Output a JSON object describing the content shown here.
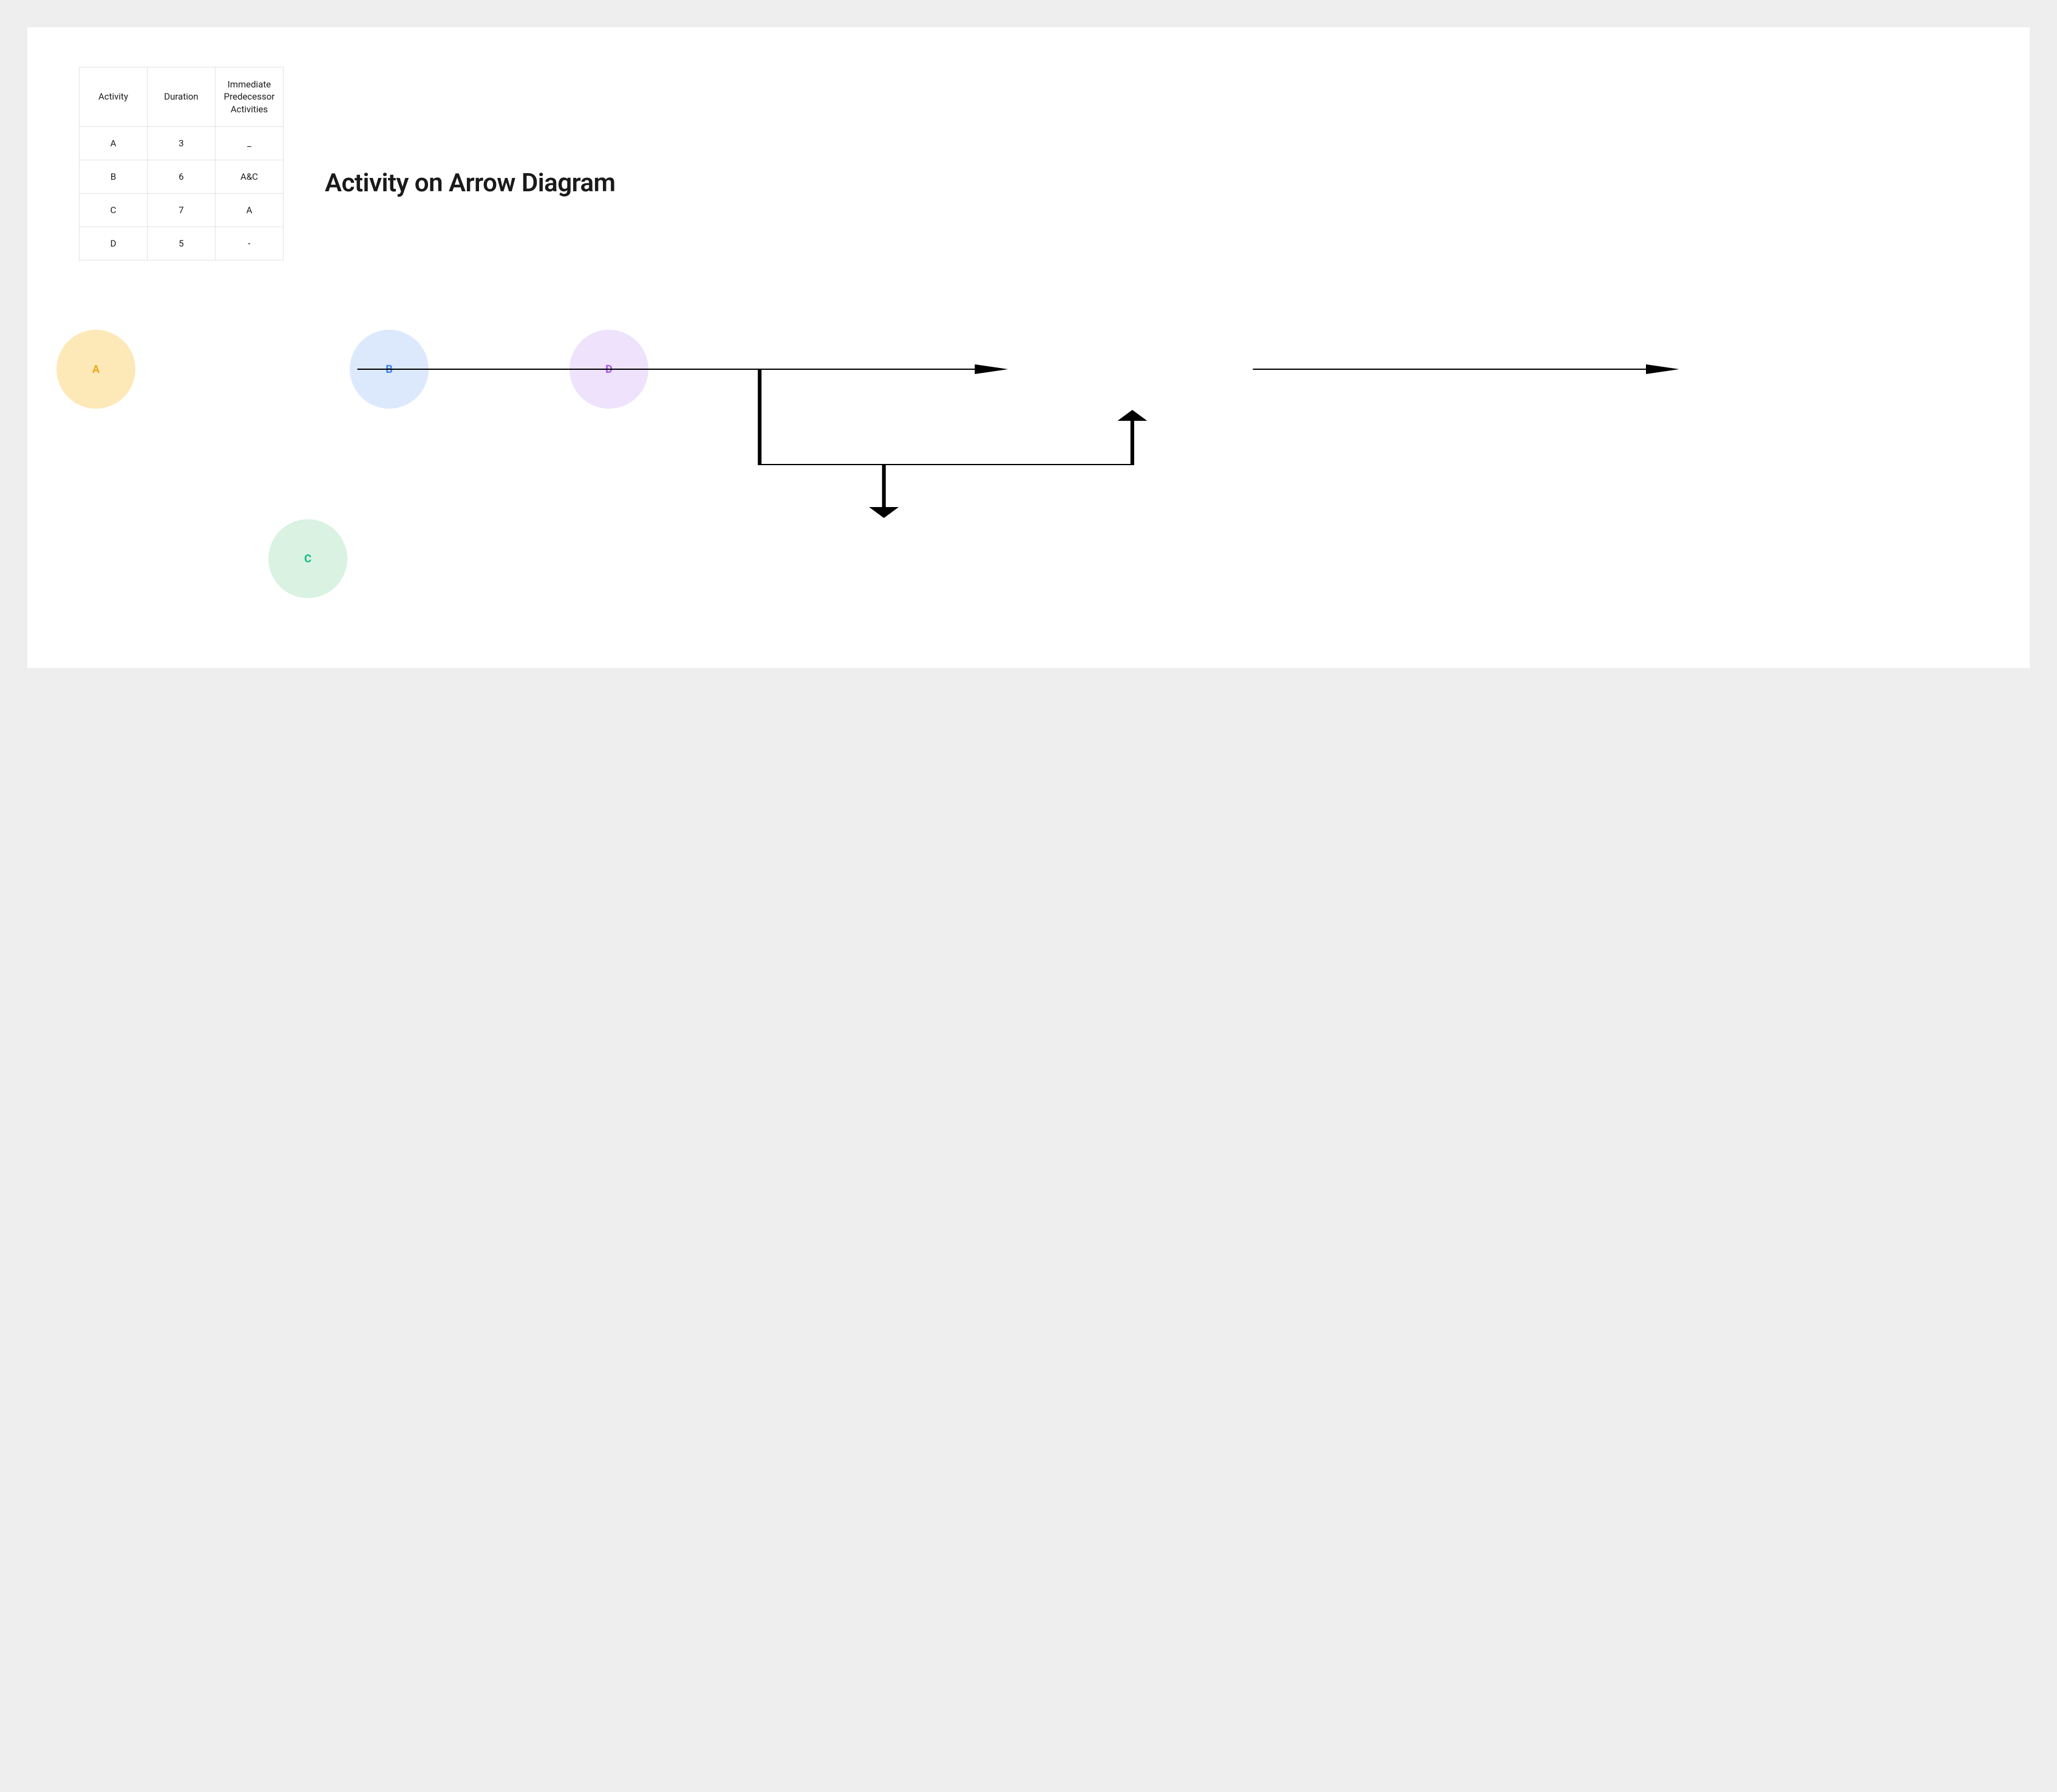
{
  "title": "Activity on Arrow Diagram",
  "table": {
    "headers": {
      "col1": "Activity",
      "col2": "Duration",
      "col3": "Immediate Predecessor Activities"
    },
    "rows": [
      {
        "activity": "A",
        "duration": "3",
        "predecessor": "_"
      },
      {
        "activity": "B",
        "duration": "6",
        "predecessor": "A&C"
      },
      {
        "activity": "C",
        "duration": "7",
        "predecessor": "A"
      },
      {
        "activity": "D",
        "duration": "5",
        "predecessor": "-"
      }
    ]
  },
  "nodes": {
    "a": {
      "label": "A"
    },
    "b": {
      "label": "B"
    },
    "c": {
      "label": "C"
    },
    "d": {
      "label": "D"
    }
  },
  "edges": [
    {
      "from": "A",
      "to": "B"
    },
    {
      "from": "A",
      "to": "C"
    },
    {
      "from": "C",
      "to": "B"
    },
    {
      "from": "B",
      "to": "D"
    }
  ]
}
